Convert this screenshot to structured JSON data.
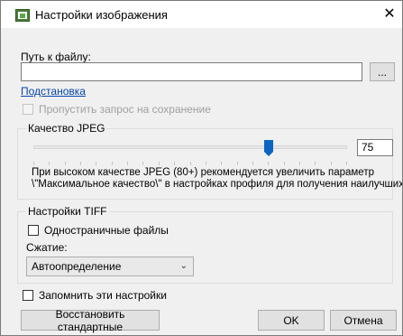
{
  "window": {
    "title": "Настройки изображения",
    "close_glyph": "✕"
  },
  "path": {
    "label": "Путь к файлу:",
    "value": "",
    "browse_label": "..."
  },
  "substitution_link": "Подстановка",
  "skip_save_prompt": {
    "label": "Пропустить запрос на сохранение",
    "checked": false,
    "enabled": false
  },
  "jpeg": {
    "group_title": "Качество JPEG",
    "quality_value": "75",
    "slider_level_fraction": 0.75,
    "hint_line1": "При высоком качестве JPEG (80+) рекомендуется увеличить параметр",
    "hint_line2": "\\\"Максимальное качество\\\" в настройках профиля для получения наилучших"
  },
  "tiff": {
    "group_title": "Настройки TIFF",
    "single_page": {
      "label": "Одностраничные файлы",
      "checked": false
    },
    "compression_label": "Сжатие:",
    "compression_value": "Автоопределение"
  },
  "remember": {
    "label": "Запомнить эти настройки",
    "checked": false
  },
  "buttons": {
    "restore_label": "Восстановить стандартные",
    "ok_label": "OK",
    "cancel_label": "Отмена"
  },
  "colors": {
    "slider_thumb": "#0a66c2",
    "link": "#0645ad"
  }
}
